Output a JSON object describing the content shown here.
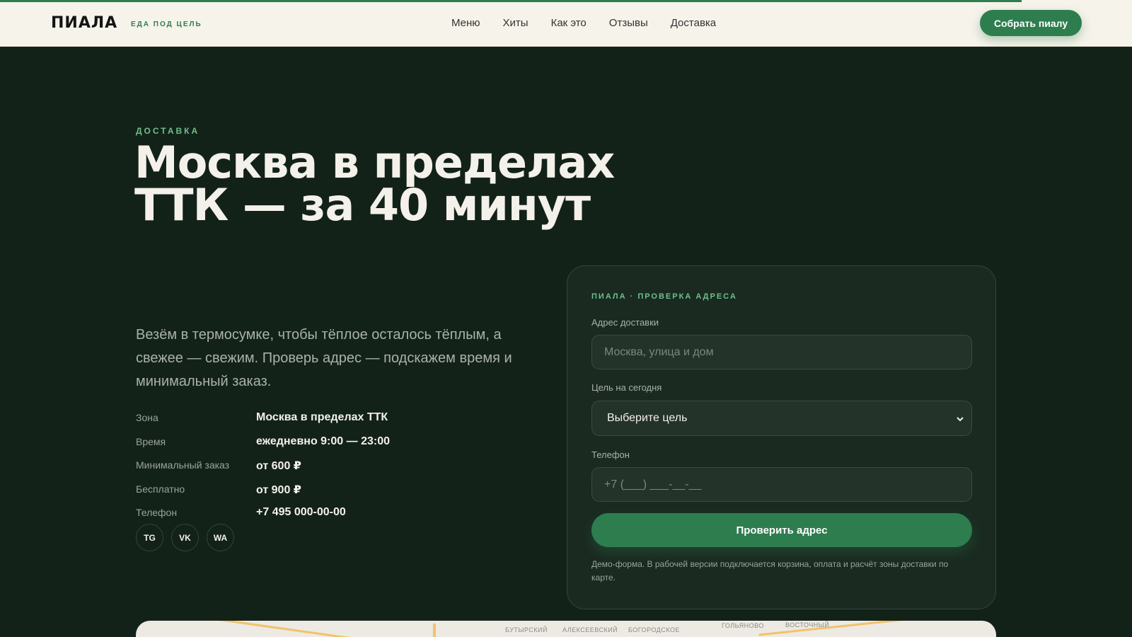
{
  "header": {
    "logo": "ПИАЛА",
    "tagline": "ЕДА ПОД ЦЕЛЬ",
    "nav": [
      "Меню",
      "Хиты",
      "Как это",
      "Отзывы",
      "Доставка"
    ],
    "cta": "Собрать пиалу"
  },
  "hero": {
    "eyebrow": "ДОСТАВКА",
    "title_line1": "Москва в пределах",
    "title_line2": "ТТК — за 40 минут",
    "lead": "Везём в термосумке, чтобы тёплое осталось тёплым, а свежее — свежим. Проверь адрес — подскажем время и минимальный заказ."
  },
  "info": [
    {
      "label": "Зона",
      "value": "Москва в пределах ТТК"
    },
    {
      "label": "Время",
      "value": "ежедневно 9:00 — 23:00"
    },
    {
      "label": "Минимальный заказ",
      "value": "от 600 ₽"
    },
    {
      "label": "Бесплатно",
      "value": "от 900 ₽"
    },
    {
      "label": "Телефон",
      "value": "+7 495 000-00-00"
    }
  ],
  "socials": [
    "TG",
    "VK",
    "WA"
  ],
  "form": {
    "eyebrow": "ПИАЛА · ПРОВЕРКА АДРЕСА",
    "address_label": "Адрес доставки",
    "address_placeholder": "Москва, улица и дом",
    "goal_label": "Цель на сегодня",
    "goal_selected": "Выберите цель",
    "phone_label": "Телефон",
    "phone_placeholder": "+7 (___) ___-__-__",
    "submit": "Проверить адрес",
    "note": "Демо-форма. В рабочей версии подключается корзина, оплата и расчёт зоны доставки по карте."
  },
  "map": {
    "labels": [
      "БУТЫРСКИЙ",
      "АЛЕКСЕЕВСКИЙ",
      "БОГОРОДСКОЕ",
      "ГОЛЬЯНОВО",
      "ВОСТОЧНЫЙ"
    ]
  },
  "colors": {
    "accent": "#2e7d4f",
    "background": "#132219",
    "header_bg": "#f6f3ea"
  }
}
